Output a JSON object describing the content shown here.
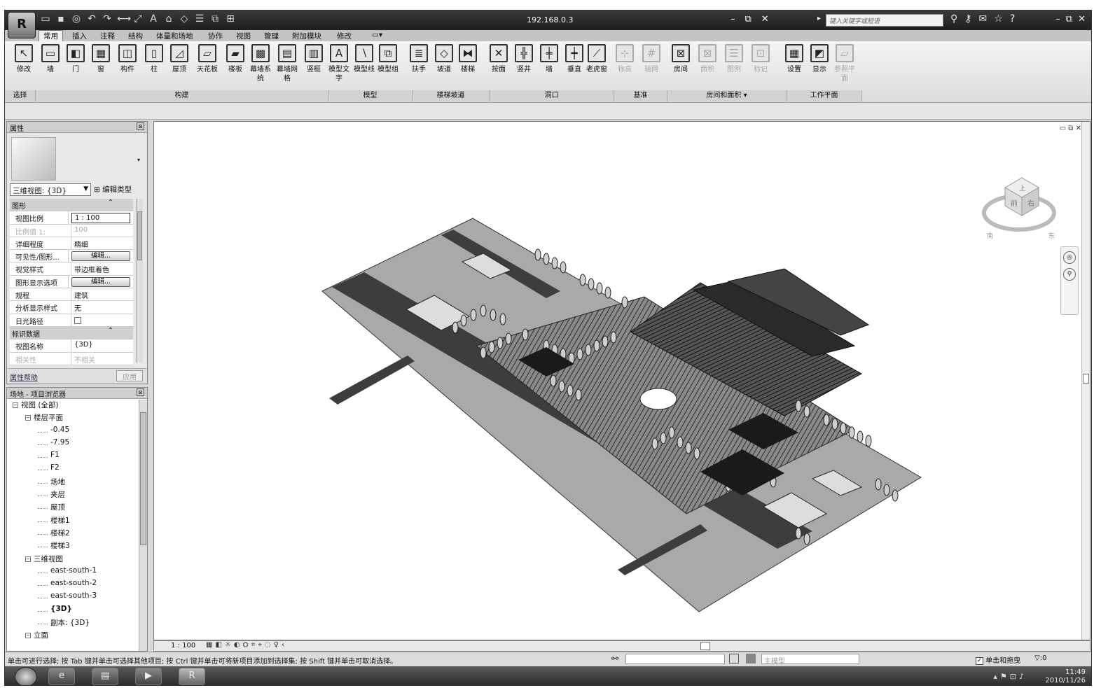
{
  "titlebar": {
    "title": "192.168.0.3",
    "search_placeholder": "键入关键字或短语"
  },
  "ribbon_tabs": [
    "常用",
    "插入",
    "注释",
    "结构",
    "体量和场地",
    "协作",
    "视图",
    "管理",
    "附加模块",
    "修改"
  ],
  "ribbon": {
    "buttons": [
      {
        "label": "修改",
        "icon": "cursor-arrow-icon",
        "glyph": "↖"
      },
      {
        "label": "墙",
        "icon": "wall-icon",
        "glyph": "▭"
      },
      {
        "label": "门",
        "icon": "door-icon",
        "glyph": "◧"
      },
      {
        "label": "窗",
        "icon": "window-icon",
        "glyph": "▦"
      },
      {
        "label": "构件",
        "icon": "component-icon",
        "glyph": "◫"
      },
      {
        "label": "柱",
        "icon": "column-icon",
        "glyph": "▯"
      },
      {
        "label": "屋顶",
        "icon": "roof-icon",
        "glyph": "◿"
      },
      {
        "label": "天花板",
        "icon": "ceiling-icon",
        "glyph": "▱"
      },
      {
        "label": "楼板",
        "icon": "floor-icon",
        "glyph": "▰"
      },
      {
        "label": "幕墙系统",
        "icon": "curtain-system-icon",
        "glyph": "▩"
      },
      {
        "label": "幕墙网格",
        "icon": "curtain-grid-icon",
        "glyph": "▤"
      },
      {
        "label": "竖梃",
        "icon": "mullion-icon",
        "glyph": "▥"
      },
      {
        "label": "模型文字",
        "icon": "model-text-icon",
        "glyph": "A"
      },
      {
        "label": "模型线",
        "icon": "model-line-icon",
        "glyph": "∖"
      },
      {
        "label": "模型组",
        "icon": "model-group-icon",
        "glyph": "⧉"
      },
      {
        "label": "扶手",
        "icon": "railing-icon",
        "glyph": "≣"
      },
      {
        "label": "坡道",
        "icon": "ramp-icon",
        "glyph": "◇"
      },
      {
        "label": "楼梯",
        "icon": "stair-icon",
        "glyph": "⧓"
      },
      {
        "label": "按面",
        "icon": "by-face-icon",
        "glyph": "✕"
      },
      {
        "label": "竖井",
        "icon": "shaft-icon",
        "glyph": "╬"
      },
      {
        "label": "墙",
        "icon": "wall-opening-icon",
        "glyph": "╪"
      },
      {
        "label": "垂直",
        "icon": "vertical-opening-icon",
        "glyph": "┿"
      },
      {
        "label": "老虎窗",
        "icon": "dormer-icon",
        "glyph": "⟋"
      },
      {
        "label": "标高",
        "icon": "level-icon",
        "glyph": "⊹"
      },
      {
        "label": "轴网",
        "icon": "grid-icon",
        "glyph": "#"
      },
      {
        "label": "房间",
        "icon": "room-icon",
        "glyph": "⊠"
      },
      {
        "label": "面积",
        "icon": "area-icon",
        "glyph": "⊠"
      },
      {
        "label": "图例",
        "icon": "legend-icon",
        "glyph": "☰"
      },
      {
        "label": "标记",
        "icon": "tag-icon",
        "glyph": "⊡"
      },
      {
        "label": "设置",
        "icon": "workplane-set-icon",
        "glyph": "▦"
      },
      {
        "label": "显示",
        "icon": "workplane-show-icon",
        "glyph": "◩"
      },
      {
        "label": "参照平面",
        "icon": "ref-plane-icon",
        "glyph": "▱"
      }
    ],
    "groups": [
      "选择",
      "构建",
      "模型",
      "楼梯坡道",
      "洞口",
      "基准",
      "房间和面积 ▾",
      "工作平面"
    ]
  },
  "properties": {
    "title": "属性",
    "type_selector": "三维视图: {3D}",
    "edit_type": "编辑类型",
    "rows": [
      {
        "kind": "section",
        "label": "图形"
      },
      {
        "label": "视图比例",
        "value": "1 : 100",
        "style": "input"
      },
      {
        "label": "比例值 1:",
        "value": "100",
        "style": "dim"
      },
      {
        "label": "详细程度",
        "value": "精细"
      },
      {
        "label": "可见性/图形...",
        "value": "编辑...",
        "style": "button"
      },
      {
        "label": "视觉样式",
        "value": "带边框着色"
      },
      {
        "label": "图形显示选项",
        "value": "编辑...",
        "style": "button"
      },
      {
        "label": "规程",
        "value": "建筑"
      },
      {
        "label": "分析显示样式",
        "value": "无"
      },
      {
        "label": "日光路径",
        "value": "",
        "style": "check"
      },
      {
        "kind": "section",
        "label": "标识数据"
      },
      {
        "label": "视图名称",
        "value": "{3D}"
      },
      {
        "label": "相关性",
        "value": "不相关",
        "style": "dim"
      }
    ],
    "help_link": "属性帮助",
    "apply_button": "应用"
  },
  "browser": {
    "title": "场地 - 项目浏览器",
    "nodes": [
      {
        "level": 0,
        "label": "视图 (全部)",
        "toggle": "⊟"
      },
      {
        "level": 1,
        "label": "楼层平面",
        "toggle": "⊟"
      },
      {
        "level": 2,
        "label": "-0.45"
      },
      {
        "level": 2,
        "label": "-7.95"
      },
      {
        "level": 2,
        "label": "F1"
      },
      {
        "level": 2,
        "label": "F2"
      },
      {
        "level": 2,
        "label": "场地"
      },
      {
        "level": 2,
        "label": "夹层"
      },
      {
        "level": 2,
        "label": "屋顶"
      },
      {
        "level": 2,
        "label": "楼梯1"
      },
      {
        "level": 2,
        "label": "楼梯2"
      },
      {
        "level": 2,
        "label": "楼梯3"
      },
      {
        "level": 1,
        "label": "三维视图",
        "toggle": "⊟"
      },
      {
        "level": 2,
        "label": "east-south-1"
      },
      {
        "level": 2,
        "label": "east-south-2"
      },
      {
        "level": 2,
        "label": "east-south-3"
      },
      {
        "level": 2,
        "label": "{3D}",
        "bold": true
      },
      {
        "level": 2,
        "label": "副本: {3D}"
      },
      {
        "level": 1,
        "label": "立面",
        "toggle": "⊟"
      }
    ]
  },
  "viewport": {
    "viewcube_top": "上",
    "viewcube_front": "前",
    "viewcube_right": "右",
    "viewcube_south": "南",
    "viewcube_east": "东",
    "scale_label": "1 : 100"
  },
  "status": {
    "message": "单击可进行选择; 按 Tab 键并单击可选择其他项目; 按 Ctrl 键并单击可将新项目添加到选择集; 按 Shift 键并单击可取消选择。",
    "model_combo": "主模型",
    "drag_label": "单击和拖曳",
    "filter_count": ":0"
  },
  "taskbar": {
    "time": "11:49",
    "date": "2010/11/26"
  }
}
